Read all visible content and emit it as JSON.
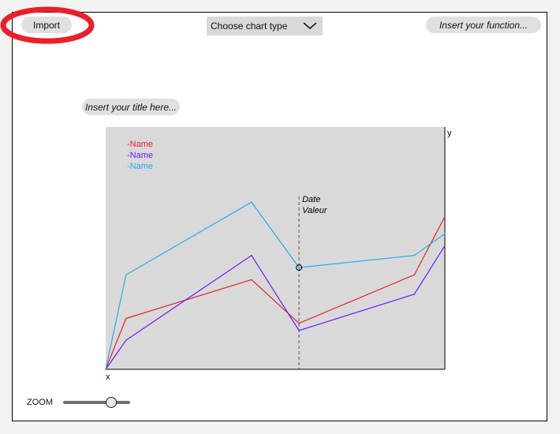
{
  "toolbar": {
    "import_label": "Import",
    "chart_type_placeholder": "Choose chart type",
    "function_placeholder": "Insert your function..."
  },
  "chart_header": {
    "title_placeholder": "Insert your title here..."
  },
  "colors": {
    "plot_bg": "#d9d9d9",
    "annotation": "#e8202a",
    "series_red": "#e8202a",
    "series_purple": "#6a1aff",
    "series_cyan": "#1eaeea"
  },
  "chart_data": {
    "type": "line",
    "xlabel": "x",
    "ylabel": "y",
    "xlim": [
      0,
      10
    ],
    "ylim": [
      0,
      10
    ],
    "x": [
      0,
      0.6,
      4.3,
      5.7,
      9.1,
      10
    ],
    "series": [
      {
        "name": "Name",
        "color": "#e8202a",
        "values": [
          0,
          2.1,
          3.7,
          1.9,
          3.9,
          6.3
        ]
      },
      {
        "name": "Name",
        "color": "#6a1aff",
        "values": [
          0,
          1.2,
          4.7,
          1.6,
          3.1,
          5.1
        ]
      },
      {
        "name": "Name",
        "color": "#1eaeea",
        "values": [
          0,
          3.9,
          6.9,
          4.2,
          4.7,
          5.6
        ]
      }
    ],
    "legend_position": "top-left",
    "marker": {
      "x": 5.7,
      "y": 4.2,
      "lines": [
        "Date",
        "Valeur"
      ]
    }
  },
  "zoom": {
    "label": "ZOOM",
    "level": 0.72
  }
}
